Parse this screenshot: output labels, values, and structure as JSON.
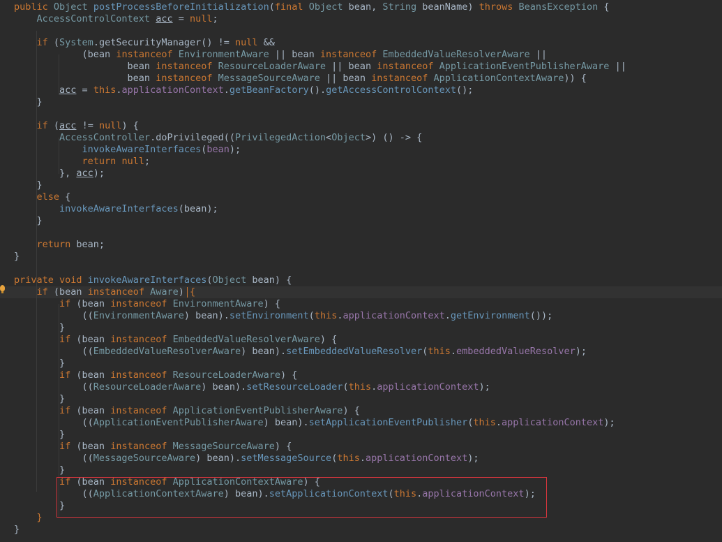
{
  "editor": {
    "language": "java",
    "theme_background": "#2b2b2b",
    "lines": [
      [
        {
          "t": "public ",
          "c": "kw"
        },
        {
          "t": "Object ",
          "c": "typ"
        },
        {
          "t": "postProcessBeforeInitialization",
          "c": "mth"
        },
        {
          "t": "(",
          "c": "pl"
        },
        {
          "t": "final ",
          "c": "kw"
        },
        {
          "t": "Object ",
          "c": "typ"
        },
        {
          "t": "bean, ",
          "c": "pl"
        },
        {
          "t": "String ",
          "c": "typ"
        },
        {
          "t": "beanName) ",
          "c": "pl"
        },
        {
          "t": "throws ",
          "c": "kw"
        },
        {
          "t": "BeansException ",
          "c": "typ"
        },
        {
          "t": "{",
          "c": "pl"
        }
      ],
      [
        {
          "t": "    AccessControlContext ",
          "c": "typ"
        },
        {
          "t": "acc",
          "c": "var"
        },
        {
          "t": " = ",
          "c": "pl"
        },
        {
          "t": "null",
          "c": "kw"
        },
        {
          "t": ";",
          "c": "pl"
        }
      ],
      [],
      [
        {
          "t": "    if ",
          "c": "kw"
        },
        {
          "t": "(",
          "c": "pl"
        },
        {
          "t": "System",
          "c": "typ"
        },
        {
          "t": ".getSecurityManager() != ",
          "c": "pl"
        },
        {
          "t": "null ",
          "c": "kw"
        },
        {
          "t": "&&",
          "c": "pl"
        }
      ],
      [
        {
          "t": "            (bean ",
          "c": "pl"
        },
        {
          "t": "instanceof ",
          "c": "kw"
        },
        {
          "t": "EnvironmentAware ",
          "c": "typ"
        },
        {
          "t": "|| bean ",
          "c": "pl"
        },
        {
          "t": "instanceof ",
          "c": "kw"
        },
        {
          "t": "EmbeddedValueResolverAware ",
          "c": "typ"
        },
        {
          "t": "||",
          "c": "pl"
        }
      ],
      [
        {
          "t": "                    bean ",
          "c": "pl"
        },
        {
          "t": "instanceof ",
          "c": "kw"
        },
        {
          "t": "ResourceLoaderAware ",
          "c": "typ"
        },
        {
          "t": "|| bean ",
          "c": "pl"
        },
        {
          "t": "instanceof ",
          "c": "kw"
        },
        {
          "t": "ApplicationEventPublisherAware ",
          "c": "typ"
        },
        {
          "t": "||",
          "c": "pl"
        }
      ],
      [
        {
          "t": "                    bean ",
          "c": "pl"
        },
        {
          "t": "instanceof ",
          "c": "kw"
        },
        {
          "t": "MessageSourceAware ",
          "c": "typ"
        },
        {
          "t": "|| bean ",
          "c": "pl"
        },
        {
          "t": "instanceof ",
          "c": "kw"
        },
        {
          "t": "ApplicationContextAware",
          "c": "typ"
        },
        {
          "t": ")) {",
          "c": "pl"
        }
      ],
      [
        {
          "t": "        ",
          "c": "pl"
        },
        {
          "t": "acc",
          "c": "var"
        },
        {
          "t": " = ",
          "c": "pl"
        },
        {
          "t": "this",
          "c": "kw"
        },
        {
          "t": ".",
          "c": "pl"
        },
        {
          "t": "applicationContext",
          "c": "fld"
        },
        {
          "t": ".",
          "c": "pl"
        },
        {
          "t": "getBeanFactory",
          "c": "mth"
        },
        {
          "t": "().",
          "c": "pl"
        },
        {
          "t": "getAccessControlContext",
          "c": "mth"
        },
        {
          "t": "();",
          "c": "pl"
        }
      ],
      [
        {
          "t": "    }",
          "c": "pl"
        }
      ],
      [],
      [
        {
          "t": "    if ",
          "c": "kw"
        },
        {
          "t": "(",
          "c": "pl"
        },
        {
          "t": "acc",
          "c": "var"
        },
        {
          "t": " != ",
          "c": "pl"
        },
        {
          "t": "null",
          "c": "kw"
        },
        {
          "t": ") {",
          "c": "pl"
        }
      ],
      [
        {
          "t": "        AccessController",
          "c": "typ"
        },
        {
          "t": ".doPrivileged((",
          "c": "pl"
        },
        {
          "t": "PrivilegedAction",
          "c": "typ"
        },
        {
          "t": "<",
          "c": "pl"
        },
        {
          "t": "Object",
          "c": "typ"
        },
        {
          "t": ">) () -> {",
          "c": "pl"
        }
      ],
      [
        {
          "t": "            ",
          "c": "pl"
        },
        {
          "t": "invokeAwareInterfaces",
          "c": "mth"
        },
        {
          "t": "(",
          "c": "pl"
        },
        {
          "t": "bean",
          "c": "fld"
        },
        {
          "t": ");",
          "c": "pl"
        }
      ],
      [
        {
          "t": "            return ",
          "c": "kw"
        },
        {
          "t": "null",
          "c": "kw"
        },
        {
          "t": ";",
          "c": "pl"
        }
      ],
      [
        {
          "t": "        }, ",
          "c": "pl"
        },
        {
          "t": "acc",
          "c": "var"
        },
        {
          "t": ");",
          "c": "pl"
        }
      ],
      [
        {
          "t": "    }",
          "c": "pl"
        }
      ],
      [
        {
          "t": "    else ",
          "c": "kw"
        },
        {
          "t": "{",
          "c": "pl"
        }
      ],
      [
        {
          "t": "        ",
          "c": "pl"
        },
        {
          "t": "invokeAwareInterfaces",
          "c": "mth"
        },
        {
          "t": "(bean);",
          "c": "pl"
        }
      ],
      [
        {
          "t": "    }",
          "c": "pl"
        }
      ],
      [],
      [
        {
          "t": "    return ",
          "c": "kw"
        },
        {
          "t": "bean;",
          "c": "pl"
        }
      ],
      [
        {
          "t": "}",
          "c": "pl"
        }
      ],
      [],
      [
        {
          "t": "private ",
          "c": "kw"
        },
        {
          "t": "void ",
          "c": "kw"
        },
        {
          "t": "invokeAwareInterfaces",
          "c": "mth"
        },
        {
          "t": "(",
          "c": "pl"
        },
        {
          "t": "Object ",
          "c": "typ"
        },
        {
          "t": "bean) {",
          "c": "pl"
        }
      ],
      [
        {
          "t": "    if ",
          "c": "kw"
        },
        {
          "t": "(bean ",
          "c": "pl"
        },
        {
          "t": "instanceof ",
          "c": "kw"
        },
        {
          "t": "Aware",
          "c": "typ"
        },
        {
          "t": ") ",
          "c": "pl"
        },
        {
          "t": "{",
          "c": "kw"
        }
      ],
      [
        {
          "t": "        if ",
          "c": "kw"
        },
        {
          "t": "(bean ",
          "c": "pl"
        },
        {
          "t": "instanceof ",
          "c": "kw"
        },
        {
          "t": "EnvironmentAware",
          "c": "typ"
        },
        {
          "t": ") {",
          "c": "pl"
        }
      ],
      [
        {
          "t": "            ((",
          "c": "pl"
        },
        {
          "t": "EnvironmentAware",
          "c": "typ"
        },
        {
          "t": ") bean).",
          "c": "pl"
        },
        {
          "t": "setEnvironment",
          "c": "mth"
        },
        {
          "t": "(",
          "c": "pl"
        },
        {
          "t": "this",
          "c": "kw"
        },
        {
          "t": ".",
          "c": "pl"
        },
        {
          "t": "applicationContext",
          "c": "fld"
        },
        {
          "t": ".",
          "c": "pl"
        },
        {
          "t": "getEnvironment",
          "c": "mth"
        },
        {
          "t": "());",
          "c": "pl"
        }
      ],
      [
        {
          "t": "        }",
          "c": "pl"
        }
      ],
      [
        {
          "t": "        if ",
          "c": "kw"
        },
        {
          "t": "(bean ",
          "c": "pl"
        },
        {
          "t": "instanceof ",
          "c": "kw"
        },
        {
          "t": "EmbeddedValueResolverAware",
          "c": "typ"
        },
        {
          "t": ") {",
          "c": "pl"
        }
      ],
      [
        {
          "t": "            ((",
          "c": "pl"
        },
        {
          "t": "EmbeddedValueResolverAware",
          "c": "typ"
        },
        {
          "t": ") bean).",
          "c": "pl"
        },
        {
          "t": "setEmbeddedValueResolver",
          "c": "mth"
        },
        {
          "t": "(",
          "c": "pl"
        },
        {
          "t": "this",
          "c": "kw"
        },
        {
          "t": ".",
          "c": "pl"
        },
        {
          "t": "embeddedValueResolver",
          "c": "fld"
        },
        {
          "t": ");",
          "c": "pl"
        }
      ],
      [
        {
          "t": "        }",
          "c": "pl"
        }
      ],
      [
        {
          "t": "        if ",
          "c": "kw"
        },
        {
          "t": "(bean ",
          "c": "pl"
        },
        {
          "t": "instanceof ",
          "c": "kw"
        },
        {
          "t": "ResourceLoaderAware",
          "c": "typ"
        },
        {
          "t": ") {",
          "c": "pl"
        }
      ],
      [
        {
          "t": "            ((",
          "c": "pl"
        },
        {
          "t": "ResourceLoaderAware",
          "c": "typ"
        },
        {
          "t": ") bean).",
          "c": "pl"
        },
        {
          "t": "setResourceLoader",
          "c": "mth"
        },
        {
          "t": "(",
          "c": "pl"
        },
        {
          "t": "this",
          "c": "kw"
        },
        {
          "t": ".",
          "c": "pl"
        },
        {
          "t": "applicationContext",
          "c": "fld"
        },
        {
          "t": ");",
          "c": "pl"
        }
      ],
      [
        {
          "t": "        }",
          "c": "pl"
        }
      ],
      [
        {
          "t": "        if ",
          "c": "kw"
        },
        {
          "t": "(bean ",
          "c": "pl"
        },
        {
          "t": "instanceof ",
          "c": "kw"
        },
        {
          "t": "ApplicationEventPublisherAware",
          "c": "typ"
        },
        {
          "t": ") {",
          "c": "pl"
        }
      ],
      [
        {
          "t": "            ((",
          "c": "pl"
        },
        {
          "t": "ApplicationEventPublisherAware",
          "c": "typ"
        },
        {
          "t": ") bean).",
          "c": "pl"
        },
        {
          "t": "setApplicationEventPublisher",
          "c": "mth"
        },
        {
          "t": "(",
          "c": "pl"
        },
        {
          "t": "this",
          "c": "kw"
        },
        {
          "t": ".",
          "c": "pl"
        },
        {
          "t": "applicationContext",
          "c": "fld"
        },
        {
          "t": ");",
          "c": "pl"
        }
      ],
      [
        {
          "t": "        }",
          "c": "pl"
        }
      ],
      [
        {
          "t": "        if ",
          "c": "kw"
        },
        {
          "t": "(bean ",
          "c": "pl"
        },
        {
          "t": "instanceof ",
          "c": "kw"
        },
        {
          "t": "MessageSourceAware",
          "c": "typ"
        },
        {
          "t": ") {",
          "c": "pl"
        }
      ],
      [
        {
          "t": "            ((",
          "c": "pl"
        },
        {
          "t": "MessageSourceAware",
          "c": "typ"
        },
        {
          "t": ") bean).",
          "c": "pl"
        },
        {
          "t": "setMessageSource",
          "c": "mth"
        },
        {
          "t": "(",
          "c": "pl"
        },
        {
          "t": "this",
          "c": "kw"
        },
        {
          "t": ".",
          "c": "pl"
        },
        {
          "t": "applicationContext",
          "c": "fld"
        },
        {
          "t": ");",
          "c": "pl"
        }
      ],
      [
        {
          "t": "        }",
          "c": "pl"
        }
      ],
      [
        {
          "t": "        if ",
          "c": "kw"
        },
        {
          "t": "(bean ",
          "c": "pl"
        },
        {
          "t": "instanceof ",
          "c": "kw"
        },
        {
          "t": "ApplicationContextAware",
          "c": "typ"
        },
        {
          "t": ") {",
          "c": "pl"
        }
      ],
      [
        {
          "t": "            ((",
          "c": "pl"
        },
        {
          "t": "ApplicationContextAware",
          "c": "typ"
        },
        {
          "t": ") bean).",
          "c": "pl"
        },
        {
          "t": "setApplicationContext",
          "c": "mth"
        },
        {
          "t": "(",
          "c": "pl"
        },
        {
          "t": "this",
          "c": "kw"
        },
        {
          "t": ".",
          "c": "pl"
        },
        {
          "t": "applicationContext",
          "c": "fld"
        },
        {
          "t": ");",
          "c": "pl"
        }
      ],
      [
        {
          "t": "        }",
          "c": "pl"
        }
      ],
      [
        {
          "t": "    }",
          "c": "kw"
        }
      ],
      [
        {
          "t": "}",
          "c": "pl"
        }
      ]
    ]
  },
  "colors": {
    "keyword": "#cc7832",
    "type": "#769aa5",
    "method": "#6897bb",
    "plain": "#a9b7c6",
    "field": "#9876aa",
    "highlight_box": "#d9363e",
    "bulb": "#e8a33d"
  },
  "icons": {
    "gutter_hint": "lightbulb-icon"
  }
}
